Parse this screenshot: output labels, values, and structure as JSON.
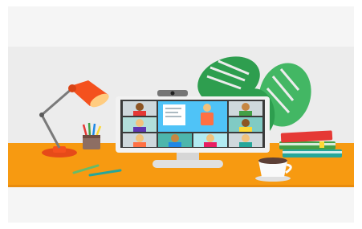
{
  "scene": {
    "description_icons": [
      "desk-lamp-icon",
      "pencil-cup-icon",
      "monitor-icon",
      "webcam-icon",
      "monstera-plant-icon",
      "book-stack-icon",
      "coffee-cup-icon",
      "pencil-icon"
    ],
    "colors": {
      "wall": "#ececec",
      "desk": "#f79a11",
      "desk_shadow": "#e98c0d",
      "lamp": "#f4511e",
      "lamp_arm": "#7a7a7a",
      "monitor_frame": "#f2f2f2",
      "screen_bg": "#3b3b3b",
      "tile_a": "#cfd8dc",
      "tile_b": "#80cbc4",
      "tile_c": "#4db6ac",
      "presenter_bg": "#4fc3f7",
      "leaf_dark": "#2e9e4f",
      "leaf_light": "#43b764",
      "book_red": "#e53935",
      "book_green": "#43a047",
      "book_teal": "#26a69a"
    },
    "video_call": {
      "participant_count": 11,
      "presenter_tile": "center-top"
    }
  }
}
